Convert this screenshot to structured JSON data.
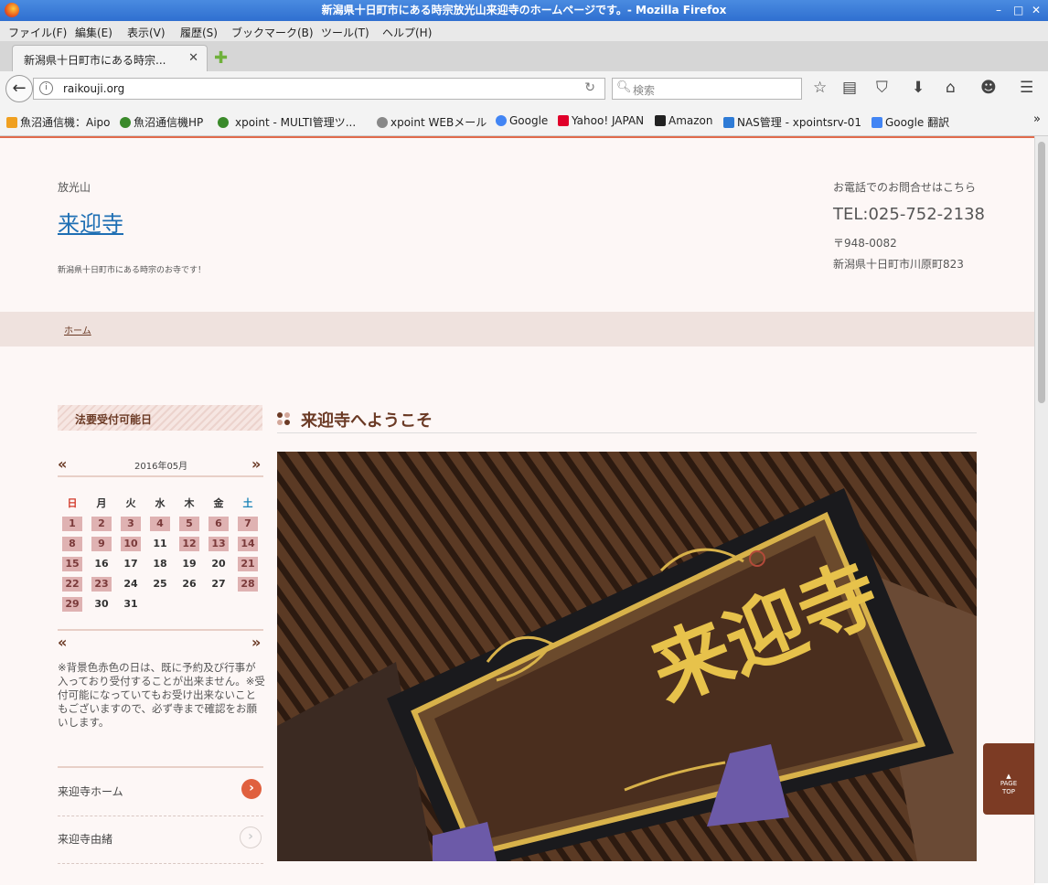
{
  "window": {
    "title": "新潟県十日町市にある時宗放光山来迎寺のホームページです。- Mozilla Firefox",
    "controls": [
      "▾",
      "–",
      "□",
      "✕"
    ]
  },
  "menubar": [
    "ファイル(F)",
    "編集(E)",
    "表示(V)",
    "履歴(S)",
    "ブックマーク(B)",
    "ツール(T)",
    "ヘルプ(H)"
  ],
  "tab": {
    "title": "新潟県十日町市にある時宗...",
    "close": "✕",
    "new_tab": "✚"
  },
  "nav": {
    "url": "raikouji.org",
    "search_placeholder": "検索",
    "back": "←",
    "info": "i",
    "reload": "↻",
    "icons": [
      "☆",
      "▤",
      "⛉",
      "⬇",
      "⌂",
      "☻",
      "☰"
    ]
  },
  "bookmarks": [
    {
      "label": "魚沼通信機：Aipo",
      "color": "#f0a020"
    },
    {
      "label": "魚沼通信機HP",
      "color": "#3a8a2a"
    },
    {
      "label": "xpoint - MULTI管理ツ...",
      "color": "#3a8a2a"
    },
    {
      "label": "xpoint WEBメール",
      "color": "#888888"
    },
    {
      "label": "Google",
      "color": "#4285f4"
    },
    {
      "label": "Yahoo! JAPAN",
      "color": "#e0002a"
    },
    {
      "label": "Amazon",
      "color": "#222222"
    },
    {
      "label": "NAS管理 - xpointsrv-01",
      "color": "#2e7bd6"
    },
    {
      "label": "Google 翻訳",
      "color": "#4285f4"
    }
  ],
  "bookmarks_more": "»",
  "site": {
    "mountain": "放光山",
    "name": "来迎寺",
    "tagline": "新潟県十日町市にある時宗のお寺です！",
    "contact_label": "お電話でのお問合せはこちら",
    "tel": "TEL:025-752-2138",
    "postal": "〒948-0082",
    "address": "新潟県十日町市川原町823",
    "nav_home": "ホーム",
    "accent": "#6b3a25"
  },
  "calendar": {
    "heading": "法要受付可能日",
    "month": "2016年05月",
    "prev": "«",
    "next": "»",
    "weekdays": [
      "日",
      "月",
      "火",
      "水",
      "木",
      "金",
      "土"
    ],
    "weeks": [
      [
        1,
        2,
        3,
        4,
        5,
        6,
        7
      ],
      [
        8,
        9,
        10,
        11,
        12,
        13,
        14
      ],
      [
        15,
        16,
        17,
        18,
        19,
        20,
        21
      ],
      [
        22,
        23,
        24,
        25,
        26,
        27,
        28
      ],
      [
        29,
        30,
        31
      ]
    ],
    "booked": [
      1,
      2,
      3,
      4,
      5,
      6,
      7,
      8,
      9,
      10,
      12,
      13,
      14,
      15,
      21,
      22,
      23,
      28,
      29
    ],
    "note": "※背景色赤色の日は、既に予約及び行事が入っており受付することが出来ません。※受付可能になっていてもお受け出来ないこともございますので、必ず寺まで確認をお願いします。"
  },
  "sidebar_links": [
    {
      "label": "来迎寺ホーム",
      "arrow": "›",
      "active": true
    },
    {
      "label": "来迎寺由緒",
      "arrow": "›",
      "active": false
    }
  ],
  "main": {
    "heading": "来迎寺へようこそ",
    "plaque_text": "来迎寺"
  },
  "page_top": {
    "line1": "PAGE",
    "line2": "TOP"
  }
}
